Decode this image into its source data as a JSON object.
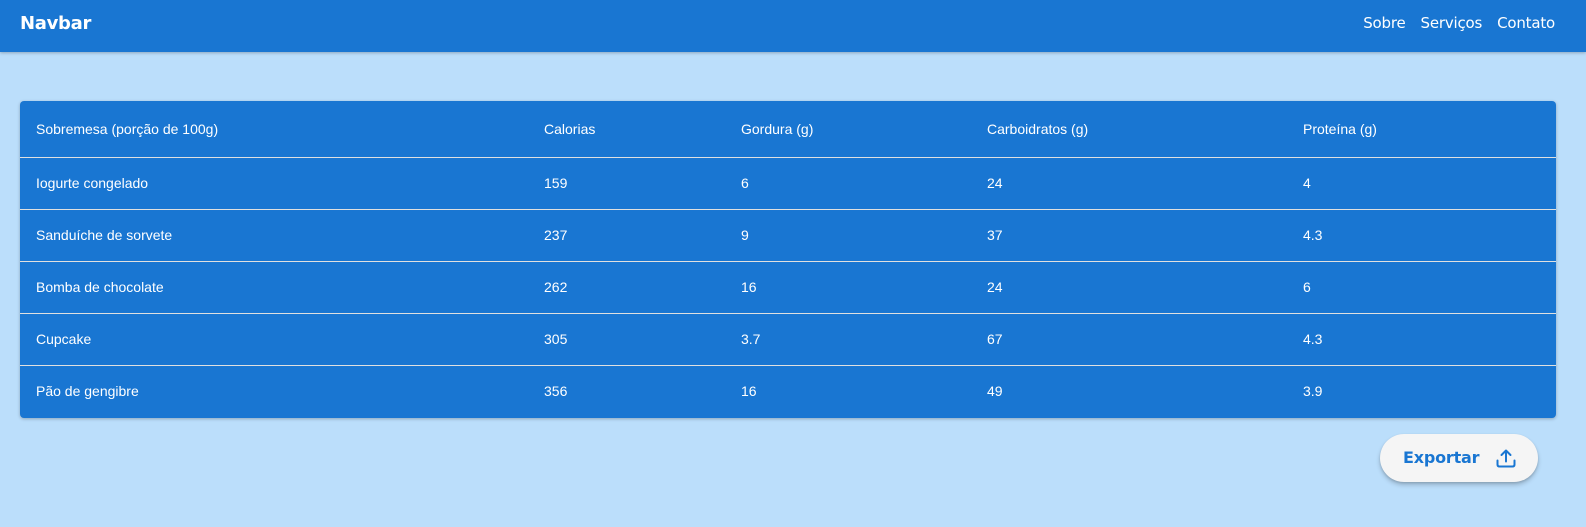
{
  "navbar": {
    "brand": "Navbar",
    "links": [
      "Sobre",
      "Serviços",
      "Contato"
    ]
  },
  "table": {
    "headers": [
      "Sobremesa (porção de 100g)",
      "Calorias",
      "Gordura (g)",
      "Carboidratos (g)",
      "Proteína (g)"
    ],
    "rows": [
      [
        "Iogurte congelado",
        "159",
        "6",
        "24",
        "4"
      ],
      [
        "Sanduíche de sorvete",
        "237",
        "9",
        "37",
        "4.3"
      ],
      [
        "Bomba de chocolate",
        "262",
        "16",
        "24",
        "6"
      ],
      [
        "Cupcake",
        "305",
        "3.7",
        "67",
        "4.3"
      ],
      [
        "Pão de gengibre",
        "356",
        "16",
        "49",
        "3.9"
      ]
    ]
  },
  "export_button": {
    "label": "Exportar",
    "icon": "upload-icon"
  },
  "colors": {
    "primary": "#1976d2",
    "background": "#bbdefb",
    "button_background": "#f5f5f5",
    "text_on_primary": "#ffffff"
  }
}
